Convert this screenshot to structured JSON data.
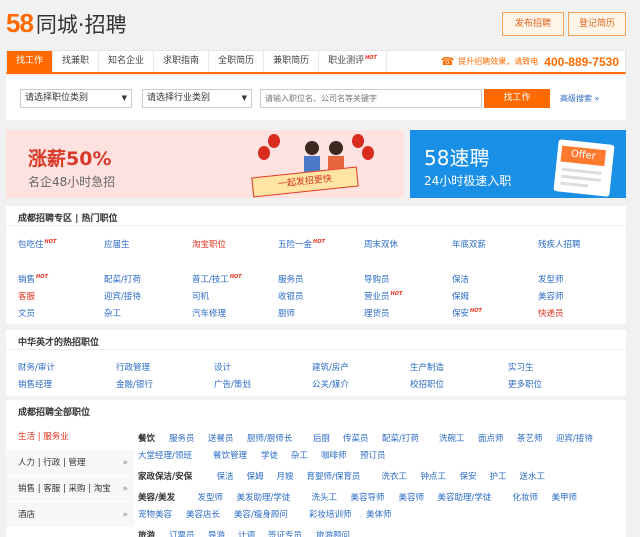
{
  "header": {
    "logo_num": "58",
    "logo_text": "同城·招聘",
    "btn_post": "发布招聘",
    "btn_resume": "登记简历"
  },
  "nav": {
    "tabs": [
      {
        "label": "找工作",
        "hot": false
      },
      {
        "label": "找兼职",
        "hot": false
      },
      {
        "label": "知名企业",
        "hot": false
      },
      {
        "label": "求职指南",
        "hot": false
      },
      {
        "label": "全职简历",
        "hot": false
      },
      {
        "label": "兼职简历",
        "hot": false
      },
      {
        "label": "职业测评",
        "hot": true
      }
    ],
    "hot_label": "HOT",
    "promo": "提升招聘效果，请致电",
    "phone": "400-889-7530"
  },
  "search": {
    "job_select": "请选择职位类别",
    "industry_select": "请选择行业类别",
    "placeholder": "请输入职位名、公司名等关键字",
    "button": "找工作",
    "advanced": "高级搜索"
  },
  "banner1": {
    "headline_a": "涨薪",
    "headline_b": "50%",
    "sub": "名企48小时急招",
    "board": "一起发招更快"
  },
  "banner2": {
    "title": "58速聘",
    "sub": "24小时极速入职",
    "offer": "Offer"
  },
  "hot_section": {
    "title": "成都招聘专区 | 热门职位",
    "row1": [
      {
        "t": "包吃住",
        "c": "blue",
        "hot": true
      },
      {
        "t": "应届生",
        "c": "blue",
        "hot": false
      },
      {
        "t": "淘宝职位",
        "c": "red",
        "hot": false
      },
      {
        "t": "五险一金",
        "c": "blue",
        "hot": true
      },
      {
        "t": "周末双休",
        "c": "blue",
        "hot": false
      },
      {
        "t": "年底双薪",
        "c": "blue",
        "hot": false
      },
      {
        "t": "残疾人招聘",
        "c": "blue",
        "hot": false
      }
    ],
    "rows": [
      [
        {
          "t": "销售",
          "c": "blue",
          "hot": true
        },
        {
          "t": "配菜/打荷",
          "c": "blue",
          "hot": false
        },
        {
          "t": "普工/技工",
          "c": "blue",
          "hot": true
        },
        {
          "t": "服务员",
          "c": "blue",
          "hot": false
        },
        {
          "t": "导购员",
          "c": "blue",
          "hot": false
        },
        {
          "t": "保洁",
          "c": "blue",
          "hot": false
        },
        {
          "t": "发型师",
          "c": "blue",
          "hot": false
        }
      ],
      [
        {
          "t": "客服",
          "c": "red",
          "hot": false
        },
        {
          "t": "迎宾/接待",
          "c": "blue",
          "hot": false
        },
        {
          "t": "司机",
          "c": "blue",
          "hot": false
        },
        {
          "t": "收银员",
          "c": "blue",
          "hot": false
        },
        {
          "t": "营业员",
          "c": "blue",
          "hot": true
        },
        {
          "t": "保姆",
          "c": "blue",
          "hot": false
        },
        {
          "t": "美容师",
          "c": "blue",
          "hot": false
        }
      ],
      [
        {
          "t": "文员",
          "c": "blue",
          "hot": false
        },
        {
          "t": "杂工",
          "c": "blue",
          "hot": false
        },
        {
          "t": "汽车修理",
          "c": "blue",
          "hot": false
        },
        {
          "t": "厨师",
          "c": "blue",
          "hot": false
        },
        {
          "t": "理货员",
          "c": "blue",
          "hot": false
        },
        {
          "t": "保安",
          "c": "blue",
          "hot": true
        },
        {
          "t": "快递员",
          "c": "red",
          "hot": false
        }
      ]
    ]
  },
  "zhonghua": {
    "title": "中华英才的热招职位",
    "rows": [
      [
        "财务/审计",
        "行政管理",
        "设计",
        "建筑/房产",
        "生产制造",
        "实习生"
      ],
      [
        "销售经理",
        "金融/银行",
        "广告/策划",
        "公关/媒介",
        "校招职位",
        "更多职位"
      ]
    ]
  },
  "all_section": {
    "title": "成都招聘全部职位",
    "side": [
      {
        "label": "生活 | 服务业",
        "active": true,
        "arrow": ""
      },
      {
        "label": "人力 | 行政 | 管理",
        "active": false,
        "arrow": "»"
      },
      {
        "label": "销售 | 客服 | 采购 | 淘宝",
        "active": false,
        "arrow": "»"
      },
      {
        "label": "酒店",
        "active": false,
        "arrow": "»"
      }
    ],
    "groups": [
      {
        "cat": "餐饮",
        "lines": [
          [
            "服务员",
            "送餐员",
            "厨师/厨师长",
            "后厨",
            "传菜员",
            "配菜/打荷",
            "洗碗工",
            "面点师",
            "茶艺师",
            "迎宾/接待"
          ],
          [
            "大堂经理/领班",
            "餐饮管理",
            "学徒",
            "杂工",
            "咖啡师",
            "预订员"
          ]
        ]
      },
      {
        "cat": "家政保洁/安保",
        "lines": [
          [
            "保洁",
            "保姆",
            "月嫂",
            "育婴师/保育员",
            "洗衣工",
            "钟点工",
            "保安",
            "护工",
            "送水工"
          ]
        ]
      },
      {
        "cat": "美容/美发",
        "lines": [
          [
            "发型师",
            "美发助理/学徒",
            "洗头工",
            "美容导师",
            "美容师",
            "美容助理/学徒",
            "化妆师",
            "美甲师"
          ],
          [
            "宠物美容",
            "美容店长",
            "美容/瘦身顾问",
            "彩妆培训师",
            "美体师"
          ]
        ]
      },
      {
        "cat": "旅游",
        "lines": [
          [
            "订票员",
            "导游",
            "计调",
            "签证专员",
            "旅游顾问"
          ]
        ]
      }
    ]
  }
}
